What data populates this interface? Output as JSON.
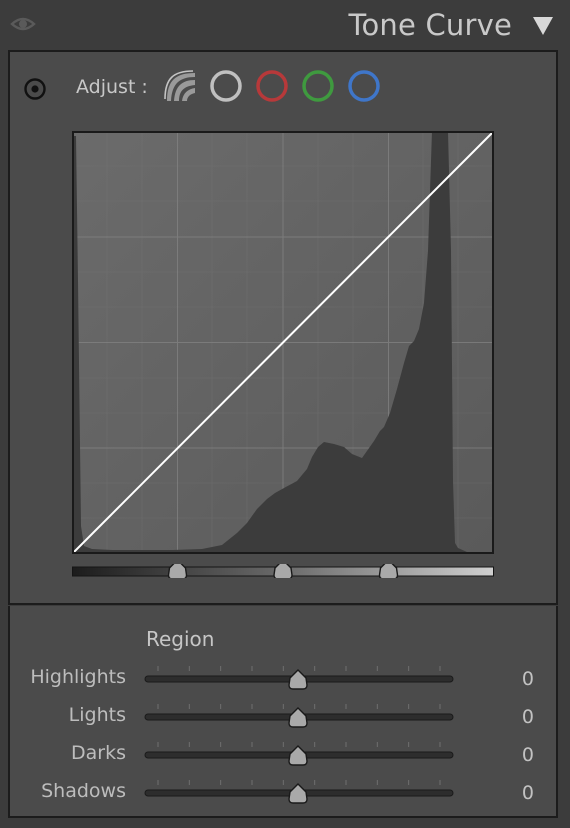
{
  "header": {
    "title": "Tone Curve"
  },
  "adjust": {
    "label": "Adjust :",
    "channels": [
      {
        "name": "parametric",
        "color": "#9a9a9a"
      },
      {
        "name": "point-rgb",
        "color": "#c0c0c0"
      },
      {
        "name": "red",
        "color": "#b7393a"
      },
      {
        "name": "green",
        "color": "#3f9a3f"
      },
      {
        "name": "blue",
        "color": "#3f76c9"
      }
    ]
  },
  "curve": {
    "split_points": [
      0.25,
      0.5,
      0.75
    ],
    "line_color": "#ffffff"
  },
  "region": {
    "label": "Region",
    "sliders": [
      {
        "label": "Highlights",
        "value": "0",
        "level": 0.5
      },
      {
        "label": "Lights",
        "value": "0",
        "level": 0.5
      },
      {
        "label": "Darks",
        "value": "0",
        "level": 0.5
      },
      {
        "label": "Shadows",
        "value": "0",
        "level": 0.5
      }
    ]
  },
  "icons": {
    "eye": "eye-icon",
    "collapse": "triangle-down-icon",
    "target": "target-adjust-icon"
  }
}
